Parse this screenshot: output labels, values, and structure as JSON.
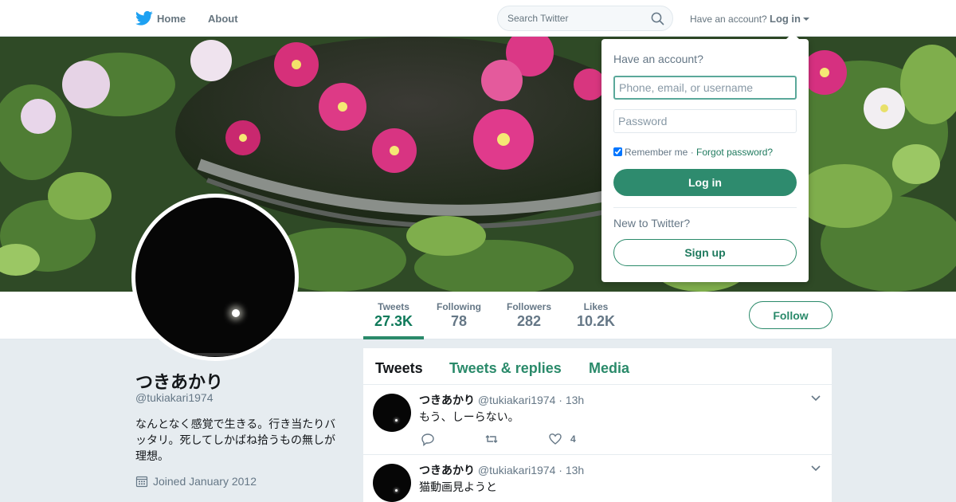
{
  "nav": {
    "home_label": "Home",
    "about_label": "About",
    "search_placeholder": "Search Twitter",
    "have_account": "Have an account?",
    "login_label": "Log in"
  },
  "login_dropdown": {
    "title": "Have an account?",
    "username_placeholder": "Phone, email, or username",
    "password_placeholder": "Password",
    "remember_me": "Remember me",
    "separator": "·",
    "forgot_password": "Forgot password?",
    "login_button": "Log in",
    "new_to_twitter": "New to Twitter?",
    "signup_button": "Sign up"
  },
  "profile": {
    "name": "つきあかり",
    "handle": "@tukiakari1974",
    "bio": "なんとなく感覚で生きる。行き当たりバッタリ。死してしかばね拾うもの無しが理想。",
    "joined": "Joined January 2012"
  },
  "stats": [
    {
      "label": "Tweets",
      "value": "27.3K"
    },
    {
      "label": "Following",
      "value": "78"
    },
    {
      "label": "Followers",
      "value": "282"
    },
    {
      "label": "Likes",
      "value": "10.2K"
    }
  ],
  "follow_button": "Follow",
  "timeline_tabs": [
    {
      "label": "Tweets"
    },
    {
      "label": "Tweets & replies"
    },
    {
      "label": "Media"
    }
  ],
  "tweets": [
    {
      "name": "つきあかり",
      "handle": "@tukiakari1974",
      "dot": "·",
      "time": "13h",
      "text": "もう、しーらない。",
      "likes": "4"
    },
    {
      "name": "つきあかり",
      "handle": "@tukiakari1974",
      "dot": "·",
      "time": "13h",
      "text": "猫動画見ようと",
      "likes": ""
    }
  ],
  "colors": {
    "accent": "#2a8a6a",
    "login_button_bg": "#2e8b6e",
    "twitter_blue": "#1da1f2"
  }
}
